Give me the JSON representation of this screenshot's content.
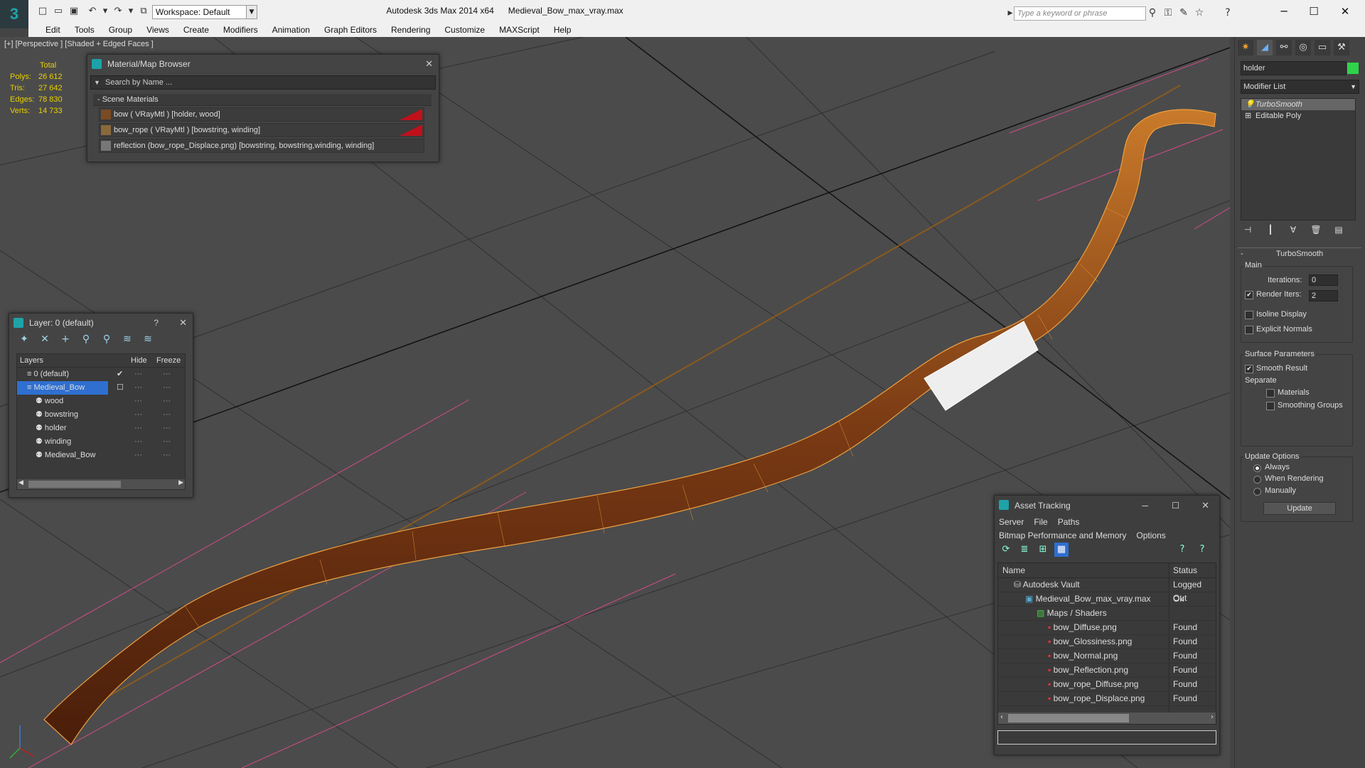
{
  "titlebar": {
    "workspace": "Workspace: Default",
    "app_name": "Autodesk 3ds Max  2014 x64",
    "file_name": "Medieval_Bow_max_vray.max",
    "search_placeholder": "Type a keyword or phrase"
  },
  "menu": [
    "Edit",
    "Tools",
    "Group",
    "Views",
    "Create",
    "Modifiers",
    "Animation",
    "Graph Editors",
    "Rendering",
    "Customize",
    "MAXScript",
    "Help"
  ],
  "viewport": {
    "label": "[+] [Perspective ] [Shaded + Edged Faces ]",
    "stats_header": "Total",
    "stats": [
      {
        "k": "Polys:",
        "v": "26 612"
      },
      {
        "k": "Tris:",
        "v": "27 642"
      },
      {
        "k": "Edges:",
        "v": "78 830"
      },
      {
        "k": "Verts:",
        "v": "14 733"
      }
    ]
  },
  "material_browser": {
    "title": "Material/Map Browser",
    "search_placeholder": "Search by Name ...",
    "section": "- Scene Materials",
    "rows": [
      {
        "label": "bow  ( VRayMtl )  [holder, wood]",
        "swatch": "#7a4a22",
        "red": true
      },
      {
        "label": "bow_rope  ( VRayMtl )  [bowstring, winding]",
        "swatch": "#8a6a3a",
        "red": true
      },
      {
        "label": "reflection (bow_rope_Displace.png) [bowstring, bowstring,winding, winding]",
        "swatch": "#777777",
        "red": false
      }
    ]
  },
  "layer_window": {
    "title": "Layer: 0 (default)",
    "help": "?",
    "headers": {
      "layers": "Layers",
      "hide": "Hide",
      "freeze": "Freeze"
    },
    "rows": [
      {
        "name": "0 (default)",
        "indent": 1,
        "selected": false,
        "check": true
      },
      {
        "name": "Medieval_Bow",
        "indent": 1,
        "selected": true,
        "check": false
      },
      {
        "name": "wood",
        "indent": 2,
        "selected": false,
        "check": false
      },
      {
        "name": "bowstring",
        "indent": 2,
        "selected": false,
        "check": false
      },
      {
        "name": "holder",
        "indent": 2,
        "selected": false,
        "check": false
      },
      {
        "name": "winding",
        "indent": 2,
        "selected": false,
        "check": false
      },
      {
        "name": "Medieval_Bow",
        "indent": 2,
        "selected": false,
        "check": false
      }
    ]
  },
  "asset_tracking": {
    "title": "Asset Tracking",
    "menu1": [
      "Server",
      "File",
      "Paths"
    ],
    "menu2": [
      "Bitmap Performance and Memory",
      "Options"
    ],
    "headers": {
      "name": "Name",
      "status": "Status"
    },
    "rows": [
      {
        "name": "Autodesk Vault",
        "status": "Logged Out",
        "indent": 1,
        "icon": "vault-icon"
      },
      {
        "name": "Medieval_Bow_max_vray.max",
        "status": "Ok",
        "indent": 2,
        "icon": "max-file-icon"
      },
      {
        "name": "Maps / Shaders",
        "status": "",
        "indent": 3,
        "icon": "maps-icon"
      },
      {
        "name": "bow_Diffuse.png",
        "status": "Found",
        "indent": 4,
        "icon": "png-icon"
      },
      {
        "name": "bow_Glossiness.png",
        "status": "Found",
        "indent": 4,
        "icon": "png-icon"
      },
      {
        "name": "bow_Normal.png",
        "status": "Found",
        "indent": 4,
        "icon": "png-icon"
      },
      {
        "name": "bow_Reflection.png",
        "status": "Found",
        "indent": 4,
        "icon": "png-icon"
      },
      {
        "name": "bow_rope_Diffuse.png",
        "status": "Found",
        "indent": 4,
        "icon": "png-icon"
      },
      {
        "name": "bow_rope_Displace.png",
        "status": "Found",
        "indent": 4,
        "icon": "png-icon"
      }
    ]
  },
  "command_panel": {
    "object_name": "holder",
    "object_color": "#2fd24a",
    "modifier_list": "Modifier List",
    "stack": [
      {
        "label": "TurboSmooth",
        "selected": true
      },
      {
        "label": "Editable Poly",
        "selected": false
      }
    ],
    "rollout_title": "TurboSmooth",
    "main_label": "Main",
    "iterations_label": "Iterations:",
    "iterations_value": "0",
    "render_iters_label": "Render Iters:",
    "render_iters_value": "2",
    "render_iters_checked": true,
    "isoline_label": "Isoline Display",
    "explicit_label": "Explicit Normals",
    "surface_label": "Surface Parameters",
    "smooth_result_label": "Smooth Result",
    "separate_label": "Separate",
    "materials_label": "Materials",
    "smoothing_groups_label": "Smoothing Groups",
    "update_options_label": "Update Options",
    "always_label": "Always",
    "when_rendering_label": "When Rendering",
    "manually_label": "Manually",
    "update_button": "Update"
  }
}
